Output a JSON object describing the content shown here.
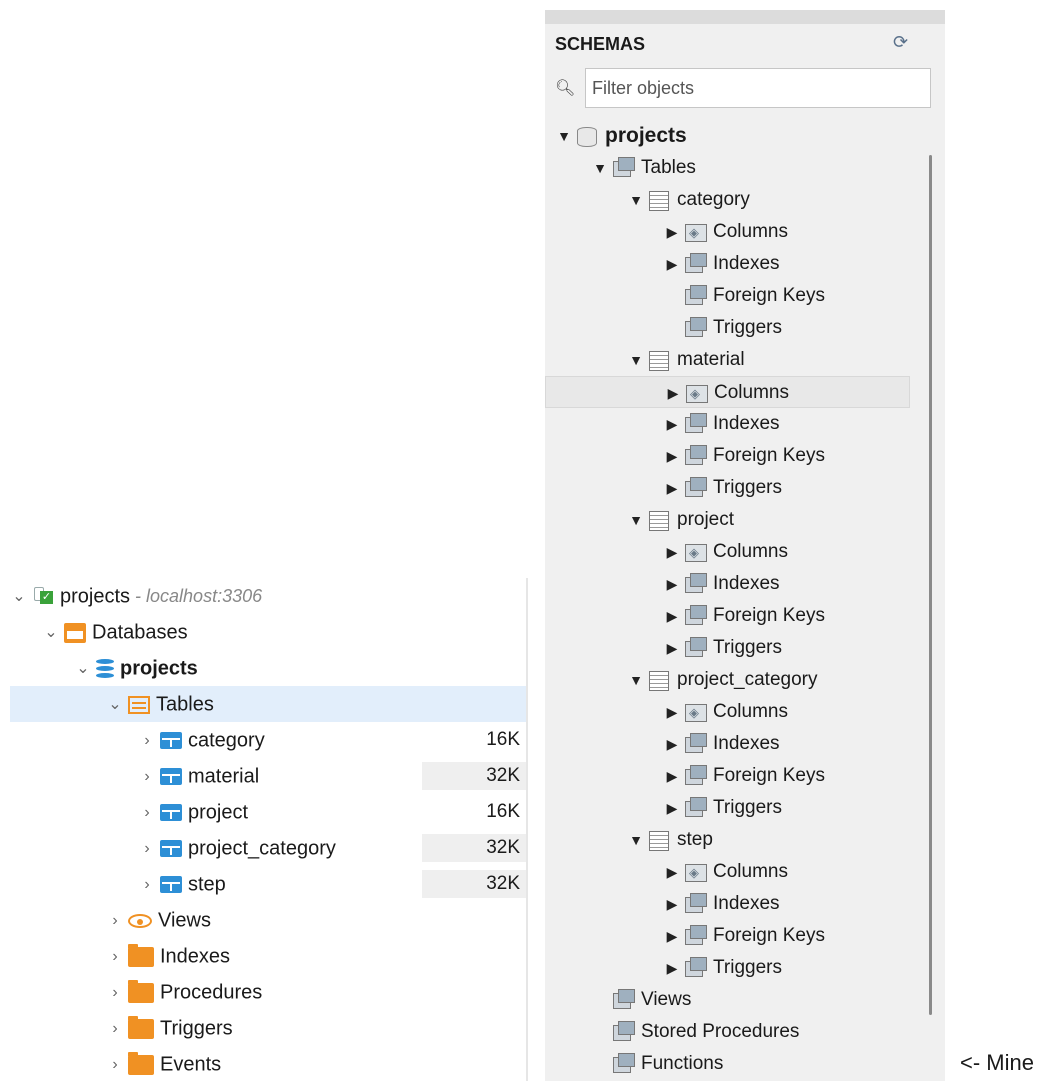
{
  "left_tree": {
    "rows": [
      {
        "label": "projects",
        "suffix": " - localhost:3306",
        "icon": "connection-icon",
        "chevron": "v",
        "depth": 0
      },
      {
        "label": "Databases",
        "icon": "databases-folder-icon",
        "chevron": "v",
        "depth": 1
      },
      {
        "label": "projects",
        "icon": "database-icon",
        "chevron": "v",
        "depth": 2,
        "bold": true
      },
      {
        "label": "Tables",
        "icon": "tables-icon",
        "chevron": "v",
        "depth": 3,
        "selected": true
      },
      {
        "label": "category",
        "icon": "table-icon",
        "chevron": ">",
        "depth": 4,
        "size": "16K"
      },
      {
        "label": "material",
        "icon": "table-icon",
        "chevron": ">",
        "depth": 4,
        "size": "32K"
      },
      {
        "label": "project",
        "icon": "table-icon",
        "chevron": ">",
        "depth": 4,
        "size": "16K"
      },
      {
        "label": "project_category",
        "icon": "table-icon",
        "chevron": ">",
        "depth": 4,
        "size": "32K"
      },
      {
        "label": "step",
        "icon": "table-icon",
        "chevron": ">",
        "depth": 4,
        "size": "32K"
      },
      {
        "label": "Views",
        "icon": "views-icon",
        "chevron": ">",
        "depth": 3
      },
      {
        "label": "Indexes",
        "icon": "folder-icon",
        "chevron": ">",
        "depth": 3
      },
      {
        "label": "Procedures",
        "icon": "folder-icon",
        "chevron": ">",
        "depth": 3
      },
      {
        "label": "Triggers",
        "icon": "folder-icon",
        "chevron": ">",
        "depth": 3
      },
      {
        "label": "Events",
        "icon": "folder-icon",
        "chevron": ">",
        "depth": 3
      }
    ]
  },
  "schemas_panel": {
    "title": "SCHEMAS",
    "filter_placeholder": "Filter objects",
    "rows": [
      {
        "label": "projects",
        "depth": 0,
        "arrow": "▼",
        "icon": "schema-icon",
        "bold": true
      },
      {
        "label": "Tables",
        "depth": 1,
        "arrow": "▼",
        "icon": "group-icon"
      },
      {
        "label": "category",
        "depth": 2,
        "arrow": "▼",
        "icon": "table-icon"
      },
      {
        "label": "Columns",
        "depth": 3,
        "arrow": "▶",
        "icon": "columns-icon"
      },
      {
        "label": "Indexes",
        "depth": 3,
        "arrow": "▶",
        "icon": "group-icon"
      },
      {
        "label": "Foreign Keys",
        "depth": 3,
        "arrow": "",
        "icon": "group-icon"
      },
      {
        "label": "Triggers",
        "depth": 3,
        "arrow": "",
        "icon": "group-icon"
      },
      {
        "label": "material",
        "depth": 2,
        "arrow": "▼",
        "icon": "table-icon"
      },
      {
        "label": "Columns",
        "depth": 3,
        "arrow": "▶",
        "icon": "columns-icon",
        "highlight": true
      },
      {
        "label": "Indexes",
        "depth": 3,
        "arrow": "▶",
        "icon": "group-icon"
      },
      {
        "label": "Foreign Keys",
        "depth": 3,
        "arrow": "▶",
        "icon": "group-icon"
      },
      {
        "label": "Triggers",
        "depth": 3,
        "arrow": "▶",
        "icon": "group-icon"
      },
      {
        "label": "project",
        "depth": 2,
        "arrow": "▼",
        "icon": "table-icon"
      },
      {
        "label": "Columns",
        "depth": 3,
        "arrow": "▶",
        "icon": "columns-icon"
      },
      {
        "label": "Indexes",
        "depth": 3,
        "arrow": "▶",
        "icon": "group-icon"
      },
      {
        "label": "Foreign Keys",
        "depth": 3,
        "arrow": "▶",
        "icon": "group-icon"
      },
      {
        "label": "Triggers",
        "depth": 3,
        "arrow": "▶",
        "icon": "group-icon"
      },
      {
        "label": "project_category",
        "depth": 2,
        "arrow": "▼",
        "icon": "table-icon"
      },
      {
        "label": "Columns",
        "depth": 3,
        "arrow": "▶",
        "icon": "columns-icon"
      },
      {
        "label": "Indexes",
        "depth": 3,
        "arrow": "▶",
        "icon": "group-icon"
      },
      {
        "label": "Foreign Keys",
        "depth": 3,
        "arrow": "▶",
        "icon": "group-icon"
      },
      {
        "label": "Triggers",
        "depth": 3,
        "arrow": "▶",
        "icon": "group-icon"
      },
      {
        "label": "step",
        "depth": 2,
        "arrow": "▼",
        "icon": "table-icon"
      },
      {
        "label": "Columns",
        "depth": 3,
        "arrow": "▶",
        "icon": "columns-icon"
      },
      {
        "label": "Indexes",
        "depth": 3,
        "arrow": "▶",
        "icon": "group-icon"
      },
      {
        "label": "Foreign Keys",
        "depth": 3,
        "arrow": "▶",
        "icon": "group-icon"
      },
      {
        "label": "Triggers",
        "depth": 3,
        "arrow": "▶",
        "icon": "group-icon"
      },
      {
        "label": "Views",
        "depth": 1,
        "arrow": "",
        "icon": "group-icon"
      },
      {
        "label": "Stored Procedures",
        "depth": 1,
        "arrow": "",
        "icon": "group-icon"
      },
      {
        "label": "Functions",
        "depth": 1,
        "arrow": "",
        "icon": "group-icon"
      }
    ]
  },
  "caption": "<- Mine"
}
